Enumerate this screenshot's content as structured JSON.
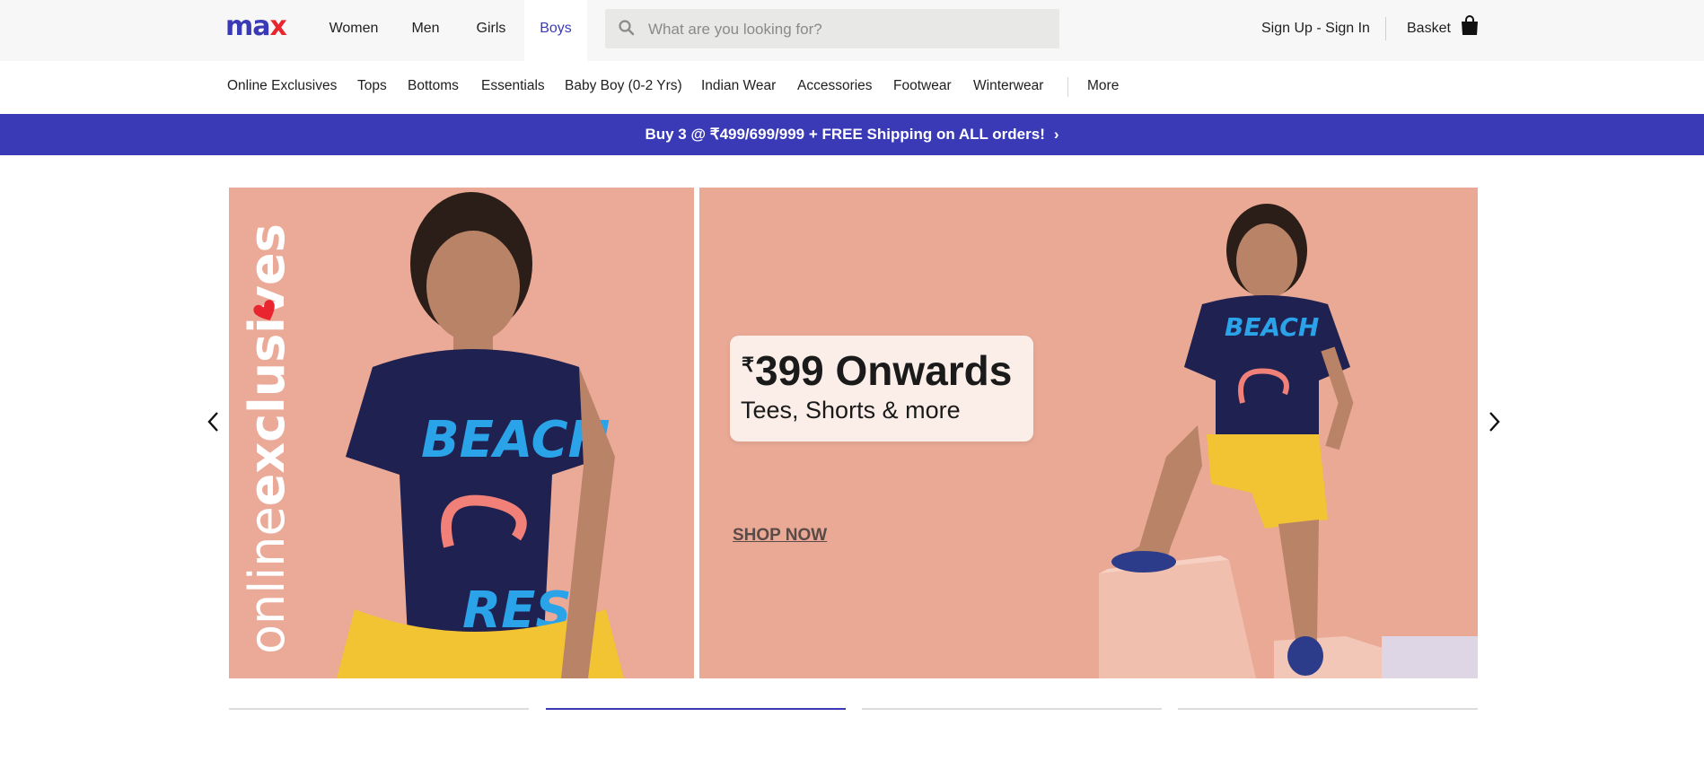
{
  "header": {
    "logo": {
      "part1": "ma",
      "part2": "x"
    },
    "departments": [
      "Women",
      "Men",
      "Girls",
      "Boys"
    ],
    "active_department": "Boys",
    "search_placeholder": "What are you looking for?",
    "signin_label": "Sign Up - Sign In",
    "basket_label": "Basket"
  },
  "categories": [
    "Online Exclusives",
    "Tops",
    "Bottoms",
    "Essentials",
    "Baby Boy (0-2 Yrs)",
    "Indian Wear",
    "Accessories",
    "Footwear",
    "Winterwear"
  ],
  "more_label": "More",
  "promo": {
    "text": "Buy 3 @ ₹499/699/999 + FREE Shipping on ALL orders!",
    "chevron": "›"
  },
  "banner": {
    "vertical_text_light": "online",
    "vertical_text_bold": "exclusives",
    "rupee_symbol": "₹",
    "price": "399 Onwards",
    "subtitle": "Tees, Shorts & more",
    "cta": "SHOP NOW"
  },
  "carousel": {
    "slide_count": 4,
    "active_index": 1
  },
  "colors": {
    "brand_blue": "#3a3ab7",
    "brand_red": "#e9262f",
    "banner_bg": "#e9a995"
  }
}
